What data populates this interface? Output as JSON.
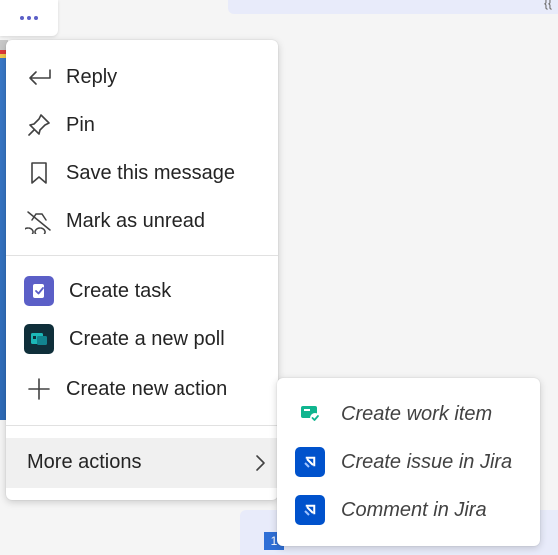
{
  "background": {
    "bottom_chip_text": "1",
    "top_bubble_glyph": "{{"
  },
  "menu": {
    "items": [
      {
        "label": "Reply",
        "icon": "reply-icon"
      },
      {
        "label": "Pin",
        "icon": "pin-icon"
      },
      {
        "label": "Save this message",
        "icon": "bookmark-icon"
      },
      {
        "label": "Mark as unread",
        "icon": "mark-unread-icon"
      },
      {
        "label": "Create task",
        "icon": "tasks-app-icon"
      },
      {
        "label": "Create a new poll",
        "icon": "poll-app-icon"
      },
      {
        "label": "Create new action",
        "icon": "plus-icon"
      }
    ],
    "more_actions": {
      "label": "More actions",
      "icon": "chevron-right-icon"
    }
  },
  "submenu": {
    "items": [
      {
        "label": "Create work item",
        "icon": "work-item-app-icon"
      },
      {
        "label": "Create issue in Jira",
        "icon": "jira-icon"
      },
      {
        "label": "Comment in Jira",
        "icon": "jira-icon"
      }
    ]
  },
  "colors": {
    "accent": "#5b5fc7",
    "tasks_app": "#5b5fc7",
    "poll_app": "#0f2f3a",
    "jira": "#0052cc",
    "work_item": "#10b58f"
  }
}
